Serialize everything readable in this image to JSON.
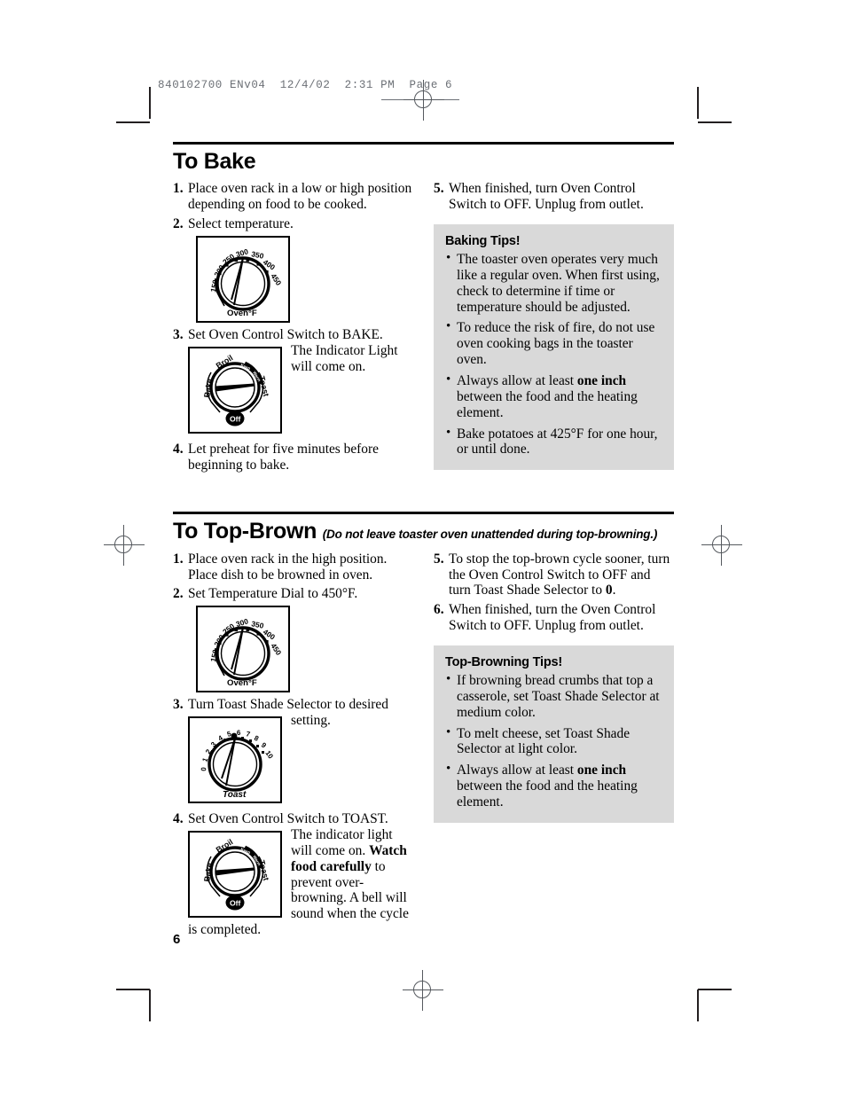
{
  "printer_slug": "840102700 ENv04  12/4/02  2:31 PM  Page 6",
  "page_number": "6",
  "sections": [
    {
      "title": "To Bake",
      "subtitle": "",
      "left_steps": [
        {
          "num": "1.",
          "text": "Place oven rack in a low or high position depending on food to be cooked."
        },
        {
          "num": "2.",
          "text": "Select temperature."
        },
        {
          "num": "3.",
          "text": "Set Oven Control Switch to BAKE.",
          "text_after_figure": "The Indicator Light will come on."
        },
        {
          "num": "4.",
          "text": "Let preheat for five minutes before beginning to bake."
        }
      ],
      "right_steps": [
        {
          "num": "5.",
          "text": "When finished, turn Oven Control Switch to OFF. Unplug from outlet."
        }
      ],
      "tips": {
        "title": "Baking Tips!",
        "items": [
          {
            "pre": "The toaster oven operates very much like a regular oven. When first using, check to determine if time or temperature should be adjusted.",
            "bold": "",
            "post": ""
          },
          {
            "pre": "To reduce the risk of fire, do not use oven cooking bags in the toaster oven.",
            "bold": "",
            "post": ""
          },
          {
            "pre": "Always allow at least ",
            "bold": "one inch",
            "post": " between the food and the heating element."
          },
          {
            "pre": "Bake potatoes at 425°F for one hour, or until done.",
            "bold": "",
            "post": ""
          }
        ]
      }
    },
    {
      "title": "To Top-Brown",
      "subtitle": "(Do not leave toaster oven unattended during top-browning.)",
      "left_steps": [
        {
          "num": "1.",
          "text": "Place oven rack in the high position. Place dish to be browned in oven."
        },
        {
          "num": "2.",
          "text": "Set Temperature Dial to 450°F."
        },
        {
          "num": "3.",
          "text": "Turn Toast Shade Selector to desired",
          "text_after_figure": "setting."
        },
        {
          "num": "4.",
          "text": "Set Oven Control Switch to TOAST.",
          "text_after_figure_pre": "The indicator light will come on. ",
          "text_after_figure_bold": "Watch food carefully",
          "text_after_figure_post": " to prevent over-browning. A bell will sound when the cycle is completed."
        }
      ],
      "right_steps": [
        {
          "num": "5.",
          "pre": "To stop the top-brown cycle sooner, turn the Oven Control Switch to OFF and turn Toast Shade Selector to ",
          "bold": "0",
          "post": "."
        },
        {
          "num": "6.",
          "pre": "When finished, turn the Oven Control Switch to OFF. Unplug from outlet.",
          "bold": "",
          "post": ""
        }
      ],
      "tips": {
        "title": "Top-Browning Tips!",
        "items": [
          {
            "pre": "If browning bread crumbs that top a casserole, set Toast Shade Selector at medium color.",
            "bold": "",
            "post": ""
          },
          {
            "pre": "To melt cheese, set Toast Shade Selector at light color.",
            "bold": "",
            "post": ""
          },
          {
            "pre": "Always allow at least ",
            "bold": "one inch",
            "post": " between the food and the heating element."
          }
        ]
      }
    }
  ],
  "dials": {
    "temperature": {
      "name": "Temperature Dial",
      "label": "Oven°F",
      "ticks": [
        "150",
        "200",
        "250",
        "300",
        "350",
        "400",
        "450"
      ]
    },
    "oven_control": {
      "name": "Oven Control Switch",
      "positions": [
        "Bake",
        "Broil",
        "Toast",
        "Off"
      ],
      "arc_label": "Keep Warm"
    },
    "toast_shade": {
      "name": "Toast Shade Selector",
      "label": "Toast",
      "ticks": [
        "0",
        "1",
        "2",
        "3",
        "4",
        "5",
        "6",
        "7",
        "8",
        "9",
        "10"
      ]
    }
  },
  "colors": {
    "tips_background": "#d9d9d9",
    "rule": "#000000",
    "slug_text": "#6c7076"
  }
}
